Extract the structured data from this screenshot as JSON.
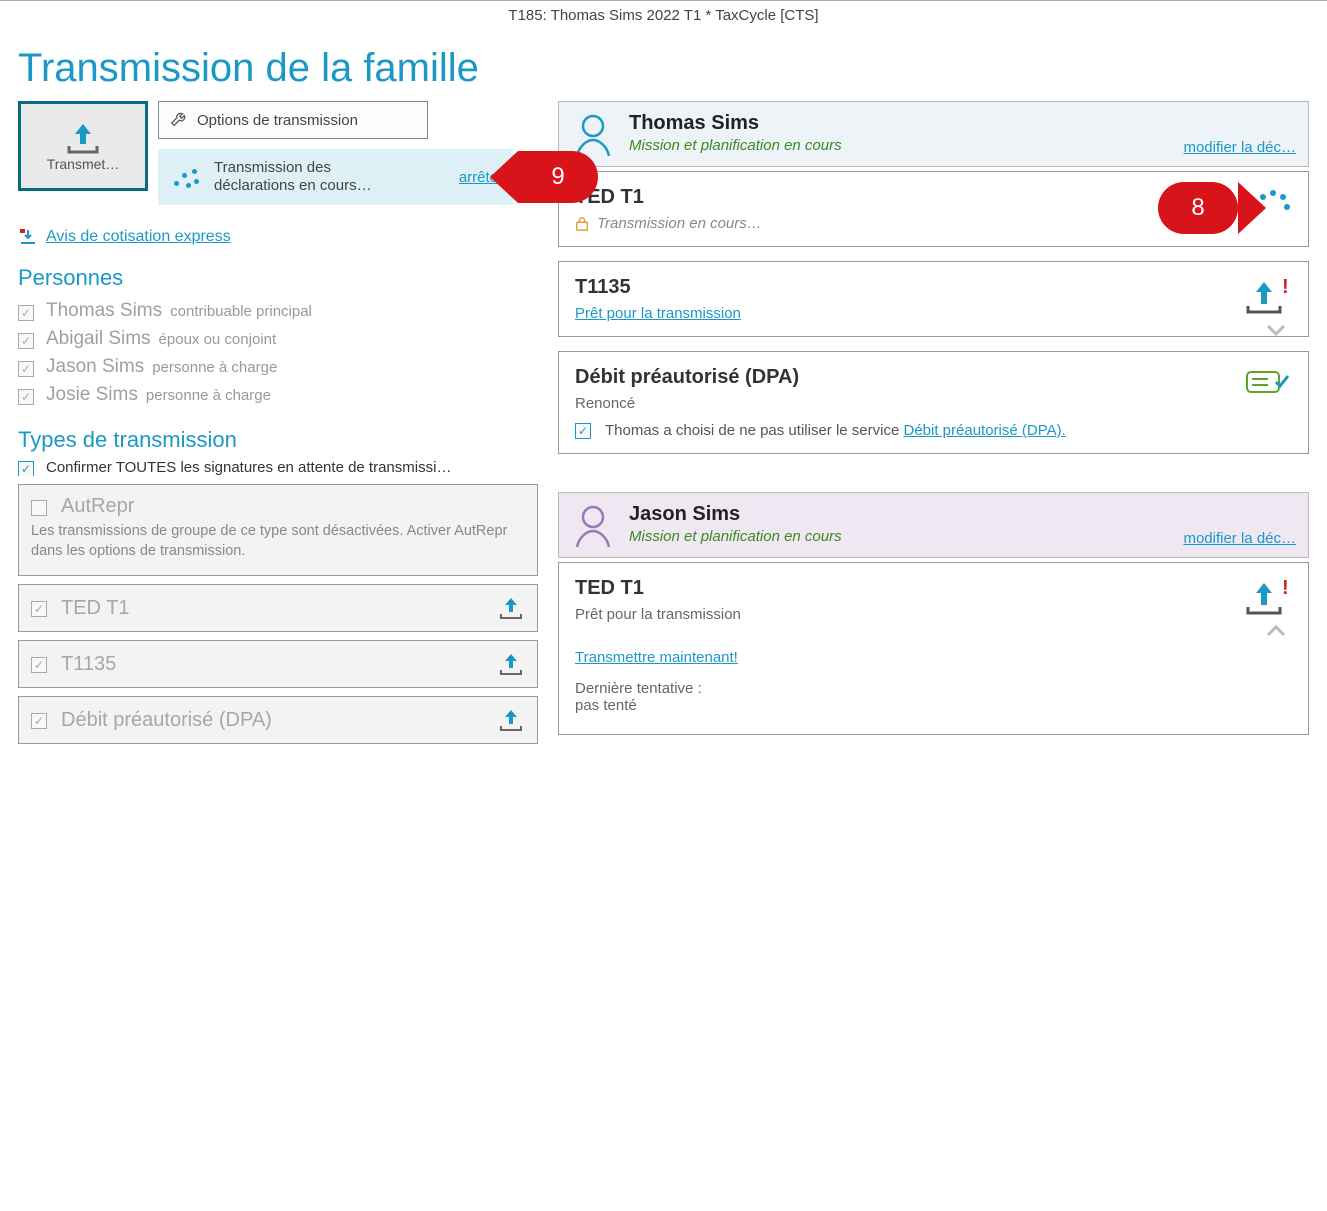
{
  "window_title": "T185: Thomas Sims 2022 T1 * TaxCycle [CTS]",
  "page_title": "Transmission de la famille",
  "actions": {
    "transmit_label": "Transmet…",
    "options_label": "Options de transmission",
    "status_text": "Transmission des déclarations en cours…",
    "stop_label": "arrêter",
    "notice_label": "Avis de cotisation express"
  },
  "callouts": {
    "c9": "9",
    "c8": "8"
  },
  "sections": {
    "people_heading": "Personnes",
    "types_heading": "Types de transmission",
    "confirm_label": "Confirmer TOUTES les signatures en attente de transmissi…"
  },
  "people": [
    {
      "name": "Thomas Sims",
      "role": "contribuable principal"
    },
    {
      "name": "Abigail Sims",
      "role": "époux ou conjoint"
    },
    {
      "name": "Jason Sims",
      "role": "personne à charge"
    },
    {
      "name": "Josie Sims",
      "role": "personne à charge"
    }
  ],
  "types": {
    "disabled": {
      "title": "AutRepr",
      "sub": "Les transmissions de groupe de ce type sont désactivées. Activer AutRepr dans les options de transmission."
    },
    "rows": [
      {
        "label": "TED T1"
      },
      {
        "label": "T1135"
      },
      {
        "label": "Débit préautorisé (DPA)"
      }
    ]
  },
  "panels": [
    {
      "name": "Thomas Sims",
      "status": "Mission et planification en cours",
      "modify_link": "modifier la déc…",
      "filings": [
        {
          "kind": "inprogress",
          "title": "TED T1",
          "sub": "Transmission en cours…"
        },
        {
          "kind": "ready",
          "title": "T1135",
          "link": "Prêt pour la transmission"
        },
        {
          "kind": "dpa",
          "title": "Débit préautorisé (DPA)",
          "sub": "Renoncé",
          "info_pre": "Thomas a choisi de ne pas utiliser le service ",
          "info_link": "Débit préautorisé (DPA)."
        }
      ]
    },
    {
      "name": "Jason Sims",
      "status": "Mission et planification en cours",
      "modify_link": "modifier la déc…",
      "filings": [
        {
          "kind": "ready2",
          "title": "TED T1",
          "sub": "Prêt pour la transmission",
          "now_link": "Transmettre maintenant!",
          "last_label": "Dernière tentative :",
          "last_value": "pas tenté"
        }
      ]
    }
  ]
}
